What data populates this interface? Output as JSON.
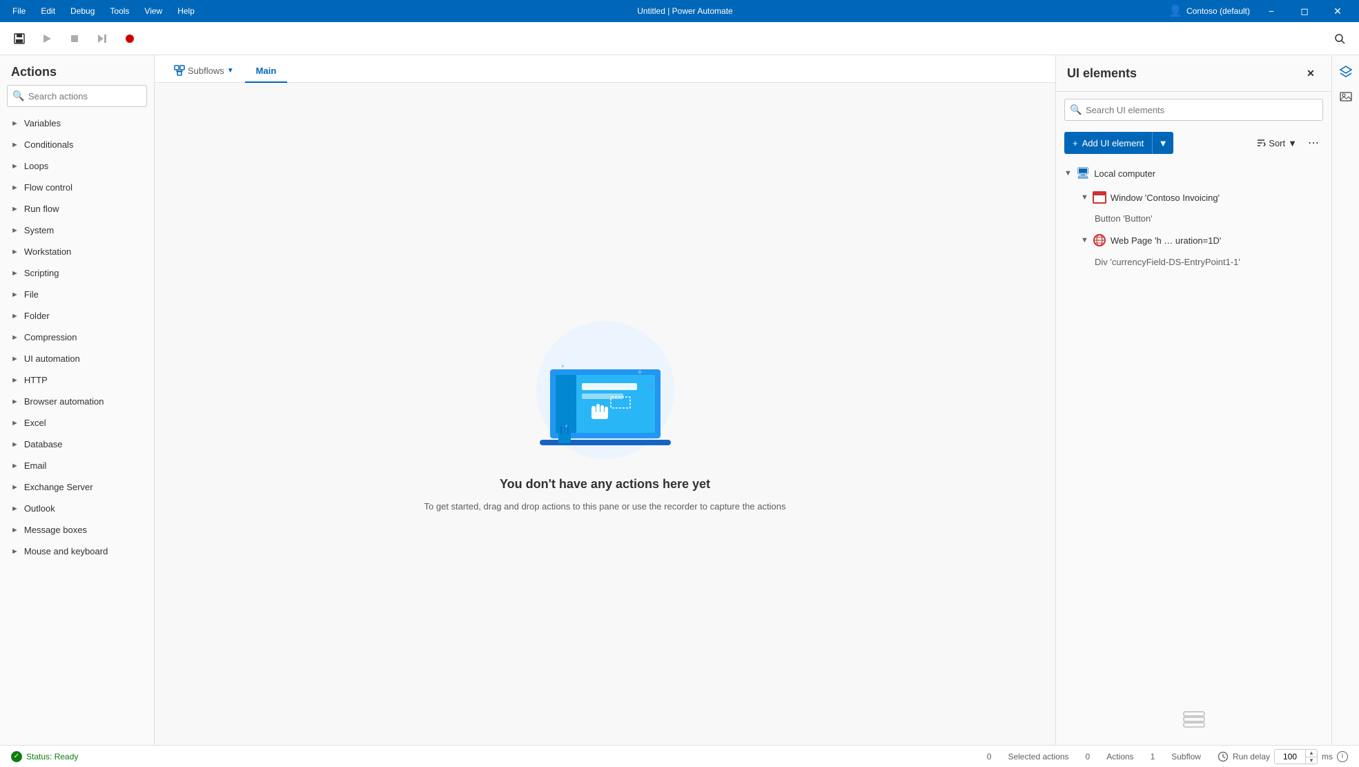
{
  "titlebar": {
    "menu": [
      "File",
      "Edit",
      "Debug",
      "Tools",
      "View",
      "Help"
    ],
    "title": "Untitled | Power Automate",
    "account": "Contoso (default)",
    "controls": [
      "minimize",
      "maximize",
      "close"
    ]
  },
  "toolbar": {
    "buttons": [
      "save",
      "run",
      "stop",
      "step",
      "record"
    ]
  },
  "actions_panel": {
    "title": "Actions",
    "search_placeholder": "Search actions",
    "items": [
      "Variables",
      "Conditionals",
      "Loops",
      "Flow control",
      "Run flow",
      "System",
      "Workstation",
      "Scripting",
      "File",
      "Folder",
      "Compression",
      "UI automation",
      "HTTP",
      "Browser automation",
      "Excel",
      "Database",
      "Email",
      "Exchange Server",
      "Outlook",
      "Message boxes",
      "Mouse and keyboard"
    ]
  },
  "flow_editor": {
    "tabs": {
      "subflows": "Subflows",
      "main": "Main"
    },
    "empty_state": {
      "title": "You don't have any actions here yet",
      "description": "To get started, drag and drop actions to this pane\nor use the recorder to capture the actions"
    }
  },
  "ui_elements_panel": {
    "title": "UI elements",
    "search_placeholder": "Search UI elements",
    "add_button": "Add UI element",
    "sort_label": "Sort",
    "tree": {
      "local_computer": "Local computer",
      "window_item": "Window 'Contoso Invoicing'",
      "button_item": "Button 'Button'",
      "webpage_item": "Web Page 'h … uration=1D'",
      "div_item": "Div 'currencyField-DS-EntryPoint1-1'"
    }
  },
  "statusbar": {
    "status": "Status: Ready",
    "selected_actions_label": "Selected actions",
    "selected_actions_count": "0",
    "actions_label": "Actions",
    "actions_count": "0",
    "subflow_label": "Subflow",
    "subflow_count": "1",
    "run_delay_label": "Run delay",
    "run_delay_value": "100",
    "run_delay_unit": "ms"
  }
}
